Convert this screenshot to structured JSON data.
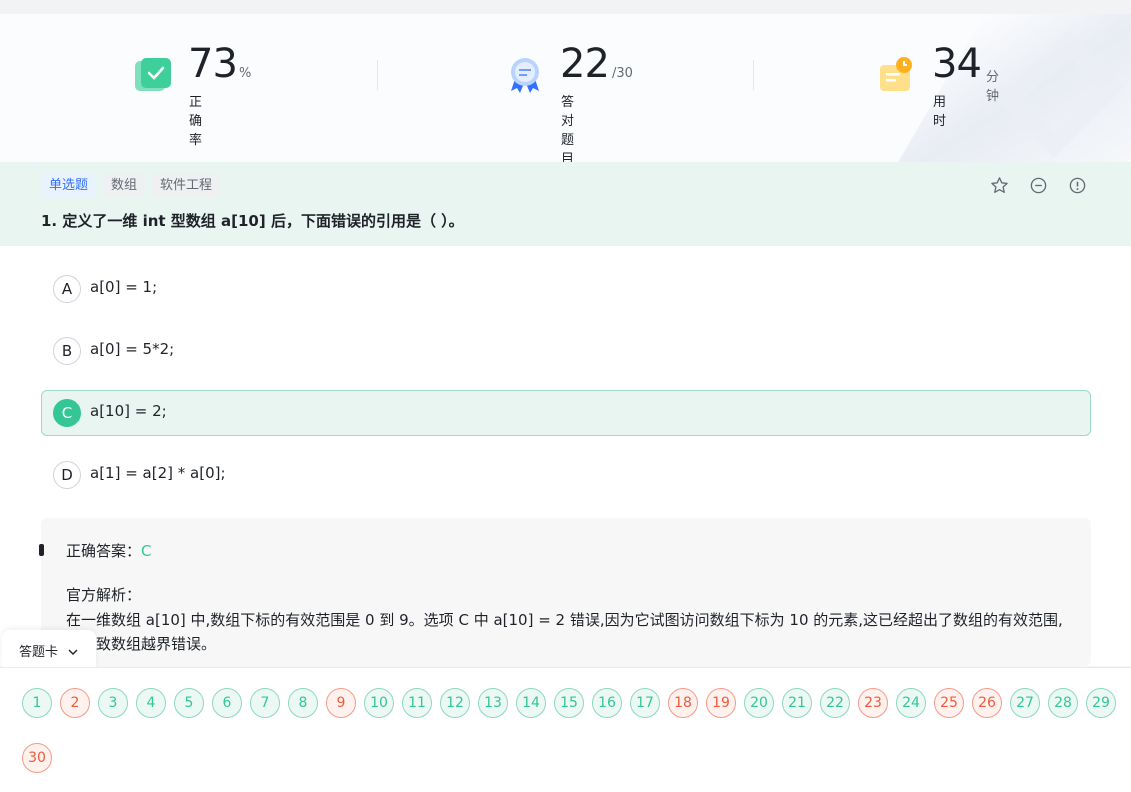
{
  "stats": {
    "accuracy": {
      "value": "73",
      "unit": "%",
      "label": "正确率",
      "icon": "accuracy-check-icon"
    },
    "correct_count": {
      "value": "22",
      "unit": "/30",
      "label": "答对题目数",
      "icon": "award-ribbon-icon"
    },
    "time_used": {
      "value": "34",
      "unit": "分钟",
      "label": "用时",
      "icon": "clock-note-icon"
    }
  },
  "question": {
    "tags": [
      "单选题",
      "数组",
      "软件工程"
    ],
    "title": "1. 定义了一维 int 型数组 a[10] 后，下面错误的引用是（   ）。",
    "icons": [
      "star-icon",
      "minus-circle-icon",
      "report-icon"
    ]
  },
  "options": [
    {
      "letter": "A",
      "text": "a[0] = 1;",
      "selected": false
    },
    {
      "letter": "B",
      "text": "a[0] = 5*2;",
      "selected": false
    },
    {
      "letter": "C",
      "text": "a[10] = 2;",
      "selected": true
    },
    {
      "letter": "D",
      "text": "a[1] = a[2] * a[0];",
      "selected": false
    }
  ],
  "answer": {
    "correct_label": "正确答案：",
    "correct_value": "C",
    "explanation_title": "官方解析：",
    "explanation_text": "在一维数组 a[10] 中,数组下标的有效范围是 0 到 9。选项 C 中 a[10] = 2 错误,因为它试图访问数组下标为 10 的元素,这已经超出了数组的有效范围,会导致数组越界错误。"
  },
  "answer_card": {
    "tab_label": "答题卡",
    "items": [
      {
        "n": "1",
        "status": "correct"
      },
      {
        "n": "2",
        "status": "wrong"
      },
      {
        "n": "3",
        "status": "correct"
      },
      {
        "n": "4",
        "status": "correct"
      },
      {
        "n": "5",
        "status": "correct"
      },
      {
        "n": "6",
        "status": "correct"
      },
      {
        "n": "7",
        "status": "correct"
      },
      {
        "n": "8",
        "status": "correct"
      },
      {
        "n": "9",
        "status": "wrong"
      },
      {
        "n": "10",
        "status": "correct"
      },
      {
        "n": "11",
        "status": "correct"
      },
      {
        "n": "12",
        "status": "correct"
      },
      {
        "n": "13",
        "status": "correct"
      },
      {
        "n": "14",
        "status": "correct"
      },
      {
        "n": "15",
        "status": "correct"
      },
      {
        "n": "16",
        "status": "correct"
      },
      {
        "n": "17",
        "status": "correct"
      },
      {
        "n": "18",
        "status": "wrong"
      },
      {
        "n": "19",
        "status": "wrong"
      },
      {
        "n": "20",
        "status": "correct"
      },
      {
        "n": "21",
        "status": "correct"
      },
      {
        "n": "22",
        "status": "correct"
      },
      {
        "n": "23",
        "status": "wrong"
      },
      {
        "n": "24",
        "status": "correct"
      },
      {
        "n": "25",
        "status": "wrong"
      },
      {
        "n": "26",
        "status": "wrong"
      },
      {
        "n": "27",
        "status": "correct"
      },
      {
        "n": "28",
        "status": "correct"
      },
      {
        "n": "29",
        "status": "correct"
      },
      {
        "n": "30",
        "status": "wrong"
      }
    ]
  },
  "colors": {
    "correct": "#34c795",
    "wrong": "#f05a3c",
    "tag_blue": "#3370ff",
    "question_bg": "#e8f5f1"
  }
}
